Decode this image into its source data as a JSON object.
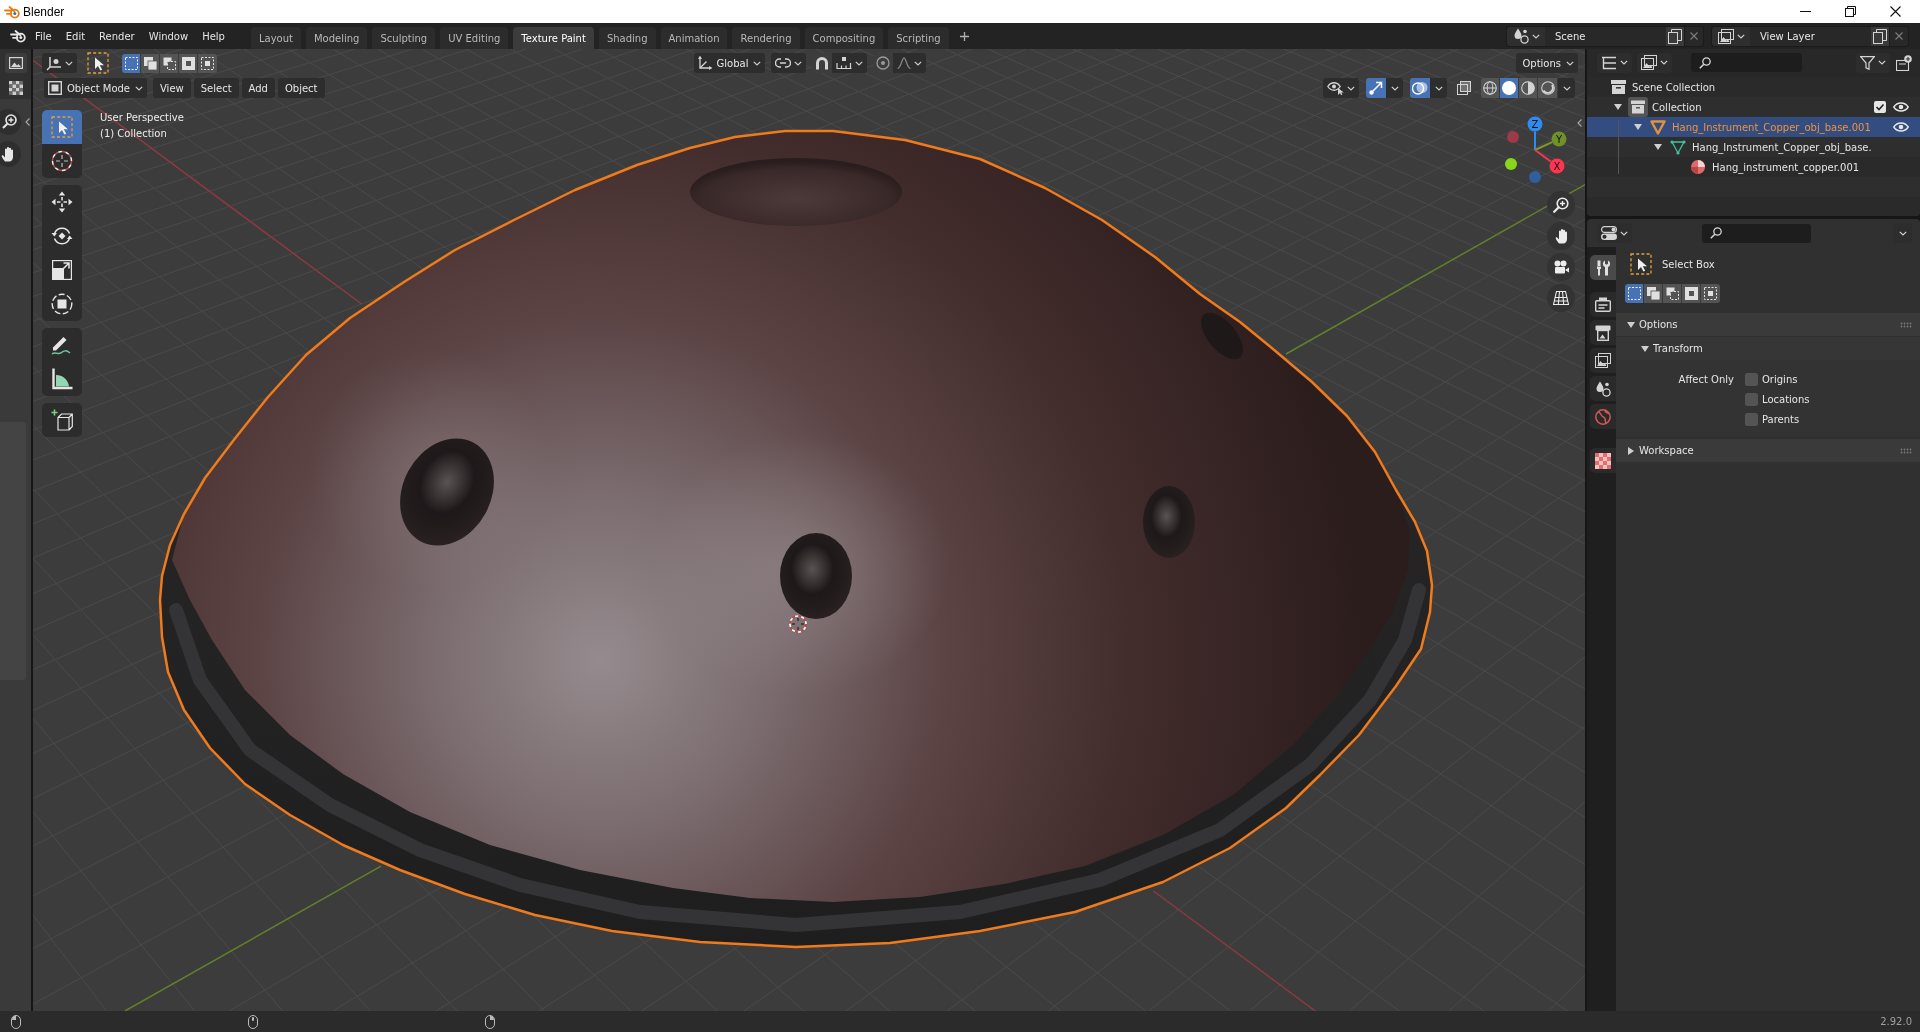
{
  "window": {
    "title": "Blender"
  },
  "menu": [
    "File",
    "Edit",
    "Render",
    "Window",
    "Help"
  ],
  "workspaces": [
    {
      "label": "Layout",
      "selected": false
    },
    {
      "label": "Modeling",
      "selected": false
    },
    {
      "label": "Sculpting",
      "selected": false
    },
    {
      "label": "UV Editing",
      "selected": false
    },
    {
      "label": "Texture Paint",
      "selected": true
    },
    {
      "label": "Shading",
      "selected": false
    },
    {
      "label": "Animation",
      "selected": false
    },
    {
      "label": "Rendering",
      "selected": false
    },
    {
      "label": "Compositing",
      "selected": false
    },
    {
      "label": "Scripting",
      "selected": false
    }
  ],
  "scene": {
    "value": "Scene"
  },
  "view_layer": {
    "value": "View Layer"
  },
  "viewport": {
    "header": {
      "select_modes": [
        {
          "selected": true
        },
        {
          "selected": false
        },
        {
          "selected": false
        },
        {
          "selected": false
        },
        {
          "selected": false
        }
      ],
      "orientation": "Global",
      "snap_on": false,
      "proportional_on": false,
      "options": "Options",
      "mode": "Object Mode",
      "menus": [
        "View",
        "Select",
        "Add",
        "Object"
      ],
      "gizmos_on": true,
      "overlays_on": true,
      "xray_on": false,
      "shading_modes": [
        {
          "selected": false
        },
        {
          "selected": true
        },
        {
          "selected": false
        },
        {
          "selected": false
        }
      ]
    },
    "tool_groups": [
      {
        "tools": [
          {
            "selected": true
          },
          {
            "selected": false
          }
        ]
      },
      {
        "tools": [
          {
            "selected": false
          },
          {
            "selected": false
          },
          {
            "selected": false
          },
          {
            "selected": false
          }
        ]
      },
      {
        "tools": [
          {
            "selected": false
          },
          {
            "selected": false
          }
        ]
      },
      {
        "tools": [
          {
            "selected": false
          }
        ]
      }
    ],
    "info": [
      "User Perspective",
      "(1) Collection"
    ],
    "gizmo": {
      "x": "X",
      "y": "Y",
      "z": "Z"
    }
  },
  "outliner": {
    "items": [
      {
        "label": "Scene Collection",
        "kind": "scene_collection",
        "selected": false,
        "children": [
          {
            "label": "Collection",
            "kind": "collection",
            "selected": false,
            "expanded": true,
            "checked": true,
            "visible": true,
            "children": [
              {
                "label": "Hang_Instrument_Copper_obj_base.001",
                "kind": "object",
                "selected": true,
                "expanded": true,
                "visible": true,
                "children": [
                  {
                    "label": "Hang_Instrument_Copper_obj_base.",
                    "kind": "mesh",
                    "selected": false,
                    "expanded": true,
                    "children": [
                      {
                        "label": "Hang_instrument_copper.001",
                        "kind": "material",
                        "selected": false
                      }
                    ]
                  }
                ]
              }
            ]
          }
        ]
      }
    ]
  },
  "properties": {
    "tab_groups": [
      {
        "tabs": [
          {
            "selected": true
          }
        ]
      },
      {
        "tabs": [
          {
            "selected": false
          },
          {
            "selected": false
          },
          {
            "selected": false
          },
          {
            "selected": false
          },
          {
            "selected": false
          }
        ]
      },
      {
        "tabs": [
          {
            "selected": false
          }
        ]
      }
    ],
    "tool": "Select Box",
    "select_modes": [
      {
        "selected": true
      },
      {
        "selected": false
      },
      {
        "selected": false
      },
      {
        "selected": false
      },
      {
        "selected": false
      }
    ],
    "panels": [
      {
        "label": "Options",
        "expanded": true,
        "subpanels": [
          {
            "label": "Transform",
            "expanded": true,
            "field_label": "Affect Only",
            "options": [
              {
                "label": "Origins",
                "checked": false
              },
              {
                "label": "Locations",
                "checked": false
              },
              {
                "label": "Parents",
                "checked": false
              }
            ]
          }
        ]
      },
      {
        "label": "Workspace",
        "expanded": false
      }
    ]
  },
  "status_bar": {
    "version": "2.92.0"
  }
}
